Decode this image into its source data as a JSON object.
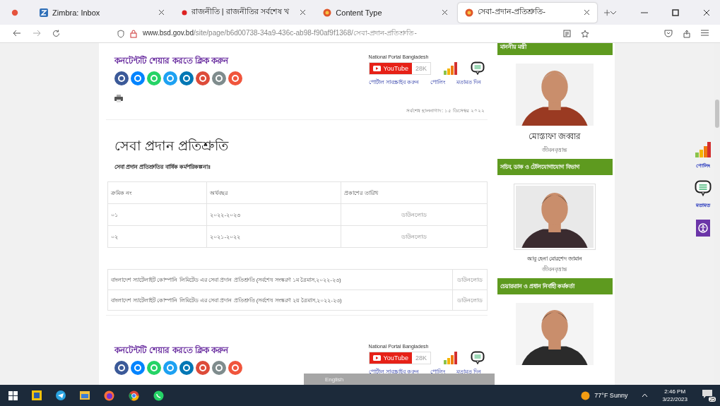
{
  "browser": {
    "tabs": [
      {
        "title": "Zimbra: Inbox",
        "kind": "zimbra",
        "selected": false
      },
      {
        "title": "রাজনীতি | রাজনীতির সর্বশেষ খ",
        "kind": "dot",
        "selected": false
      },
      {
        "title": "Content Type",
        "kind": "portal",
        "selected": false
      },
      {
        "title": "সেবা-প্রদান-প্রতিশ্রুতি-",
        "kind": "portal",
        "selected": true
      }
    ],
    "url_host": "www.bsd.gov.bd",
    "url_path": "/site/page/b6d00738-34a9-436c-ab98-f90af9f1368/সেবা-প্রদান-প্রতিশ্রুতি-"
  },
  "share_blocks": [
    {
      "heading": "কনটেন্টটি শেয়ার করতে ক্লিক করুন",
      "portal": "National Portal Bangladesh",
      "youtube": "YouTube",
      "count": "28K",
      "links": [
        "পোর্টাল সাবস্ক্রাইব করুন",
        "পোলিং",
        "মতামত দিন"
      ]
    },
    {
      "heading": "কনটেন্টটি শেয়ার করতে ক্লিক করুন",
      "portal": "National Portal Bangladesh",
      "youtube": "YouTube",
      "count": "28K",
      "links": [
        "পোর্টাল সাবস্ক্রাইব করুন",
        "পোলিং",
        "মতামত দিন"
      ]
    }
  ],
  "last_updated": "সর্বশেষ হালনাগাদ: ১৫ ডিসেম্বর ২০২২",
  "title": "সেবা প্রদান প্রতিশ্রুতি",
  "subtitle": "সেবা প্রদান প্রতিশ্রুতির বার্ষিক কর্মপরিকল্পনাঃ",
  "plan_table": {
    "columns": [
      "ক্রমিক নং",
      "অর্থবছর",
      "প্রকাশের তারিখ"
    ],
    "rows": [
      [
        "০১",
        "২০২২-২০২৩",
        "ডাউনলোড"
      ],
      [
        "০২",
        "২০২১-২০২২",
        "ডাউনলোড"
      ]
    ]
  },
  "documents": [
    {
      "title": "বাংলাদেশ স্যাটেলাইট কোম্পানি লিমিটেড এর সেবা প্রদান প্রতিশ্রুতি (সর্বশেষ সংস্করণ ১ম ত্রৈমাস,২০২২-২৩)",
      "link": "ডাউনলোড"
    },
    {
      "title": "বাংলাদেশ স্যাটেলাইট কোম্পানি লিমিটেড এর সেবা প্রদান প্রতিশ্রুতি (সর্বশেষ সংস্করণ ২য় ত্রৈমাস,২০২২-২৩)",
      "link": "ডাউনলোড"
    }
  ],
  "sidebar": [
    {
      "heading": "মাননীয় মন্ত্রী",
      "name": "মোস্তাফা জব্বার",
      "link": "জীবনবৃত্তান্ত"
    },
    {
      "heading": "সচিব, ডাক ও টেলিযোগাযোগ বিভাগ",
      "name": "আবু হেনা মোরশেদ জামান",
      "link": "জীবনবৃত্তান্ত"
    },
    {
      "heading": "চেয়ারম্যান ও প্রধান নির্বাহী কর্মকর্তা"
    }
  ],
  "side_tools": [
    {
      "label": "পোলিং",
      "kind": "poll"
    },
    {
      "label": "মতামত",
      "kind": "chat"
    },
    {
      "kind": "access"
    }
  ],
  "language_bar": {
    "label": "English"
  },
  "taskbar": {
    "weather": "77°F  Sunny",
    "time": "2:46 PM",
    "date": "3/22/2023",
    "notifications": "25"
  }
}
